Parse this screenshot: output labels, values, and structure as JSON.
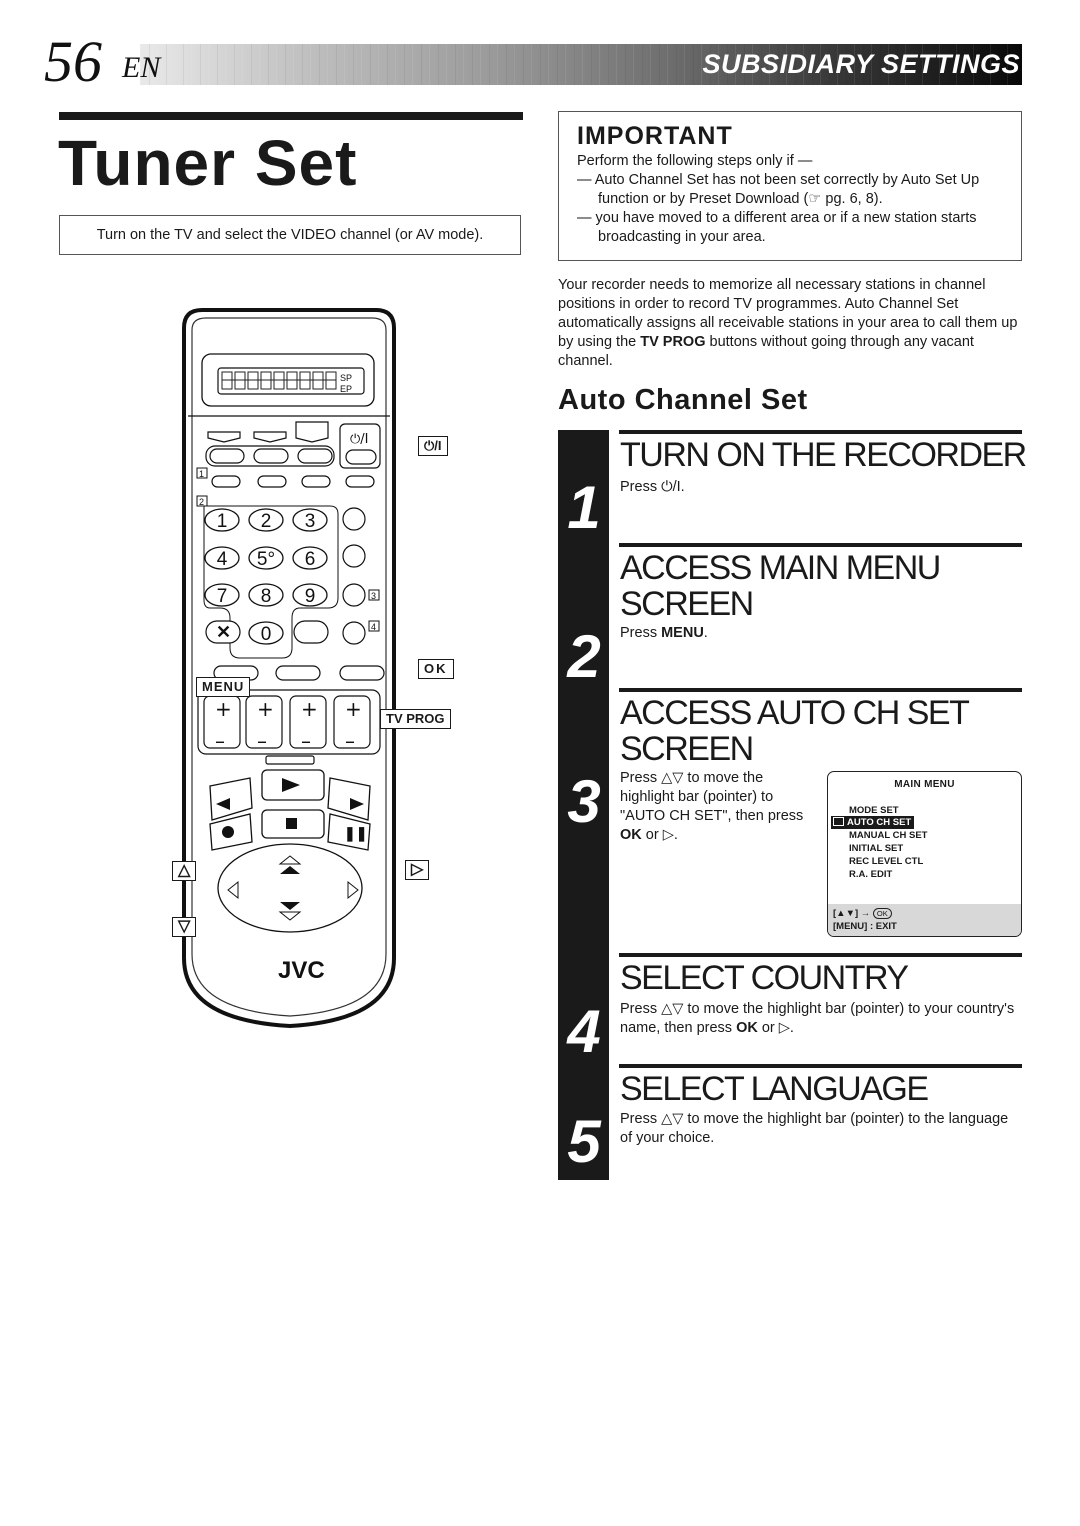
{
  "header": {
    "page_number": "56",
    "language": "EN",
    "section": "SUBSIDIARY SETTINGS"
  },
  "page_title": "Tuner Set",
  "tv_note": "Turn on the TV and select the VIDEO channel (or AV mode).",
  "important": {
    "heading": "IMPORTANT",
    "lead": "Perform the following steps only if —",
    "bullets": [
      "— Auto Channel Set has not been set correctly by Auto Set Up function or by Preset Download (☞ pg. 6, 8).",
      "— you have moved to a different area or if a new station starts broadcasting in your area."
    ]
  },
  "intro": {
    "before": "Your recorder needs to memorize all necessary stations in channel positions in order to record TV programmes. Auto Channel Set automatically assigns all receivable stations in your area to call them up by using the ",
    "bold": "TV PROG",
    "after": " buttons without going through any vacant channel."
  },
  "subheading": "Auto Channel Set",
  "steps": [
    {
      "number": "1",
      "title": "TURN ON THE RECORDER",
      "text_before": "Press ",
      "bold": "",
      "text_after": "⏻/I."
    },
    {
      "number": "2",
      "title_line1": "ACCESS MAIN MENU",
      "title_line2": "SCREEN",
      "text_before": "Press ",
      "bold": "MENU",
      "text_after": "."
    },
    {
      "number": "3",
      "title_line1": "ACCESS AUTO CH SET",
      "title_line2": "SCREEN",
      "text_before": "Press △▽ to move the highlight bar (pointer) to \"AUTO CH SET\", then press ",
      "bold": "OK",
      "text_after": " or ▷."
    },
    {
      "number": "4",
      "title": "SELECT COUNTRY",
      "text_before": "Press △▽ to move the highlight bar (pointer) to your country's name, then press ",
      "bold": "OK",
      "text_after": " or ▷."
    },
    {
      "number": "5",
      "title": "SELECT LANGUAGE",
      "text_before": "Press △▽ to move the highlight bar (pointer) to the language of your choice.",
      "bold": "",
      "text_after": ""
    }
  ],
  "main_menu": {
    "title": "MAIN MENU",
    "items": [
      "MODE SET",
      "AUTO CH SET",
      "MANUAL CH SET",
      "INITIAL SET",
      "REC LEVEL CTL",
      "R.A. EDIT"
    ],
    "selected": "AUTO CH SET",
    "footer_nav": "[▲▼] →",
    "footer_ok": "OK",
    "footer_exit": "[MENU] : EXIT"
  },
  "remote": {
    "brand": "JVC",
    "display_mode_top": "SP",
    "display_mode_bottom": "EP",
    "power_label": "⏻/I",
    "keypad": [
      "1",
      "2",
      "3",
      "4",
      "5°",
      "6",
      "7",
      "8",
      "9",
      "0"
    ],
    "badges": [
      "1",
      "2",
      "3",
      "4"
    ],
    "callouts": {
      "power": "⏻/I",
      "ok": "OK",
      "menu": "MENU",
      "tv_prog": "TV PROG",
      "up": "△",
      "down": "▽",
      "right": "▷"
    }
  }
}
